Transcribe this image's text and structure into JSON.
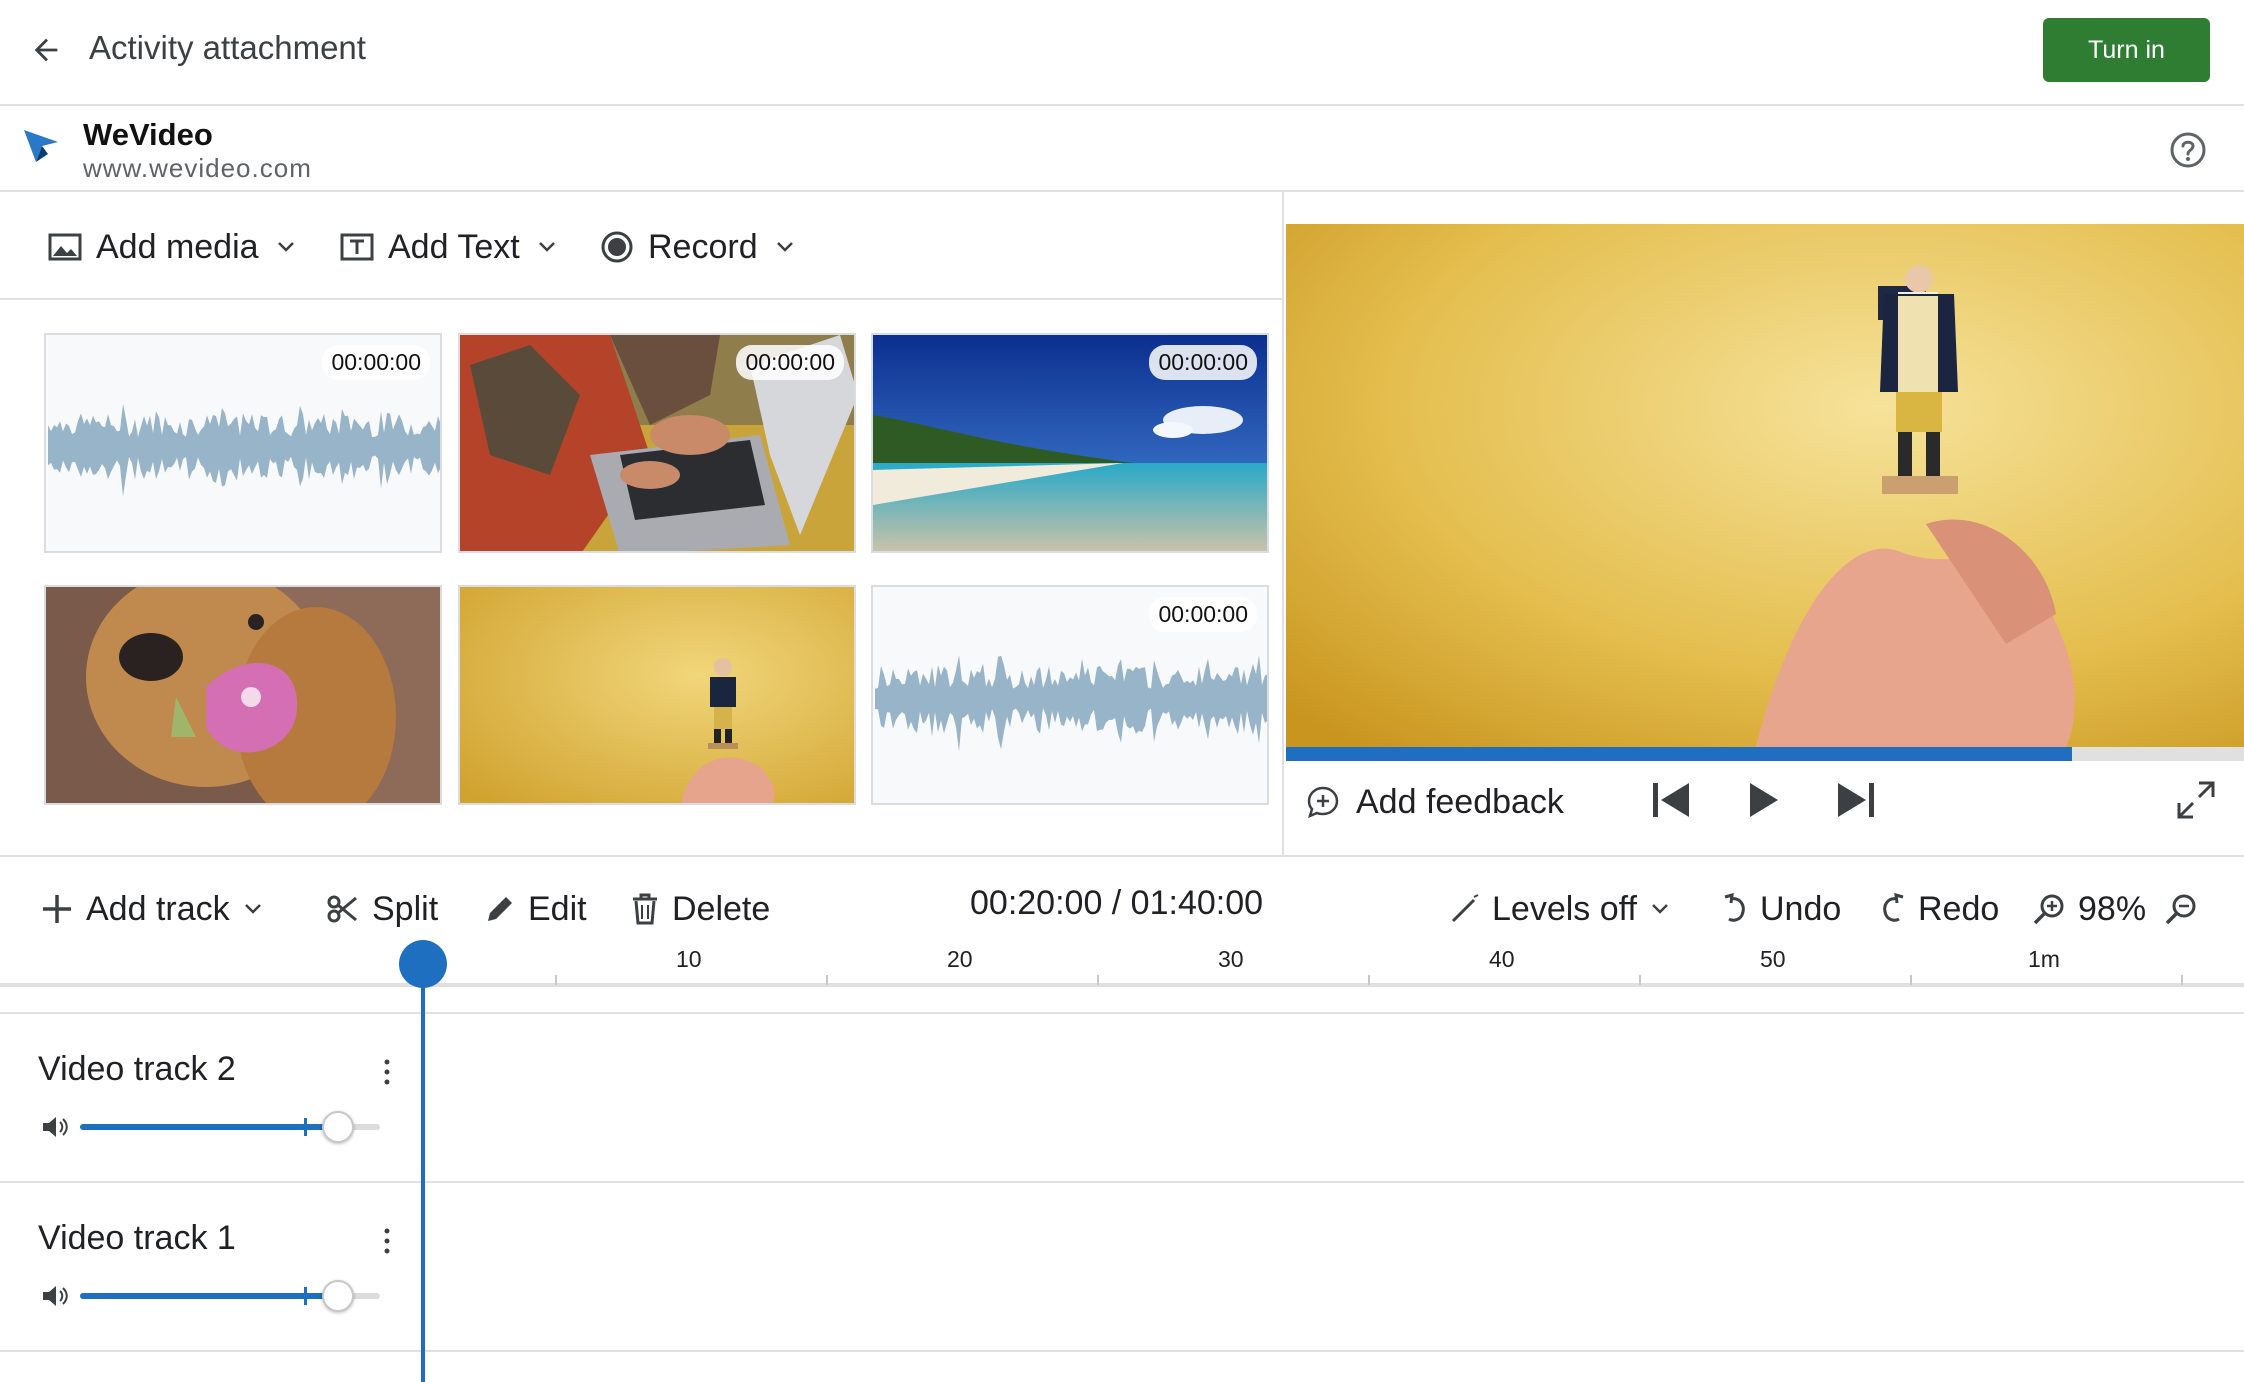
{
  "header": {
    "title": "Activity attachment",
    "turn_in_label": "Turn in"
  },
  "app": {
    "name": "WeVideo",
    "url": "www.wevideo.com"
  },
  "media_toolbar": {
    "add_media": "Add media",
    "add_text": "Add Text",
    "record": "Record"
  },
  "media_grid": [
    {
      "kind": "audio",
      "duration": "00:00:00"
    },
    {
      "kind": "video",
      "subject": "laptop",
      "duration": "00:00:00"
    },
    {
      "kind": "video",
      "subject": "beach",
      "duration": "00:00:00"
    },
    {
      "kind": "image",
      "subject": "dog-with-flower"
    },
    {
      "kind": "image",
      "subject": "figurine"
    },
    {
      "kind": "audio",
      "duration": "00:00:00"
    }
  ],
  "preview": {
    "progress_fraction": 0.82,
    "add_feedback": "Add feedback"
  },
  "timeline_toolbar": {
    "add_track": "Add track",
    "split": "Split",
    "edit": "Edit",
    "delete": "Delete",
    "timecode": "00:20:00 / 01:40:00",
    "levels": "Levels off",
    "undo": "Undo",
    "redo": "Redo",
    "zoom": "98%"
  },
  "ruler": {
    "labels": [
      "10",
      "20",
      "30",
      "40",
      "50",
      "1m"
    ]
  },
  "tracks": [
    {
      "name": "Video track 2",
      "volume_fraction": 0.86
    },
    {
      "name": "Video track 1",
      "volume_fraction": 0.86
    }
  ],
  "colors": {
    "accent": "#1e6fbf",
    "turn_in": "#2e7d32",
    "waveform": "#98b4c8"
  },
  "icons": [
    "back-arrow-icon",
    "wevideo-logo-icon",
    "help-icon",
    "image-icon",
    "text-box-icon",
    "record-icon",
    "chevron-down-icon",
    "add-feedback-icon",
    "skip-back-icon",
    "play-icon",
    "skip-forward-icon",
    "fullscreen-icon",
    "plus-icon",
    "scissors-icon",
    "pencil-icon",
    "trash-icon",
    "levels-icon",
    "undo-icon",
    "redo-icon",
    "zoom-in-icon",
    "zoom-out-icon",
    "volume-icon",
    "more-vert-icon"
  ]
}
